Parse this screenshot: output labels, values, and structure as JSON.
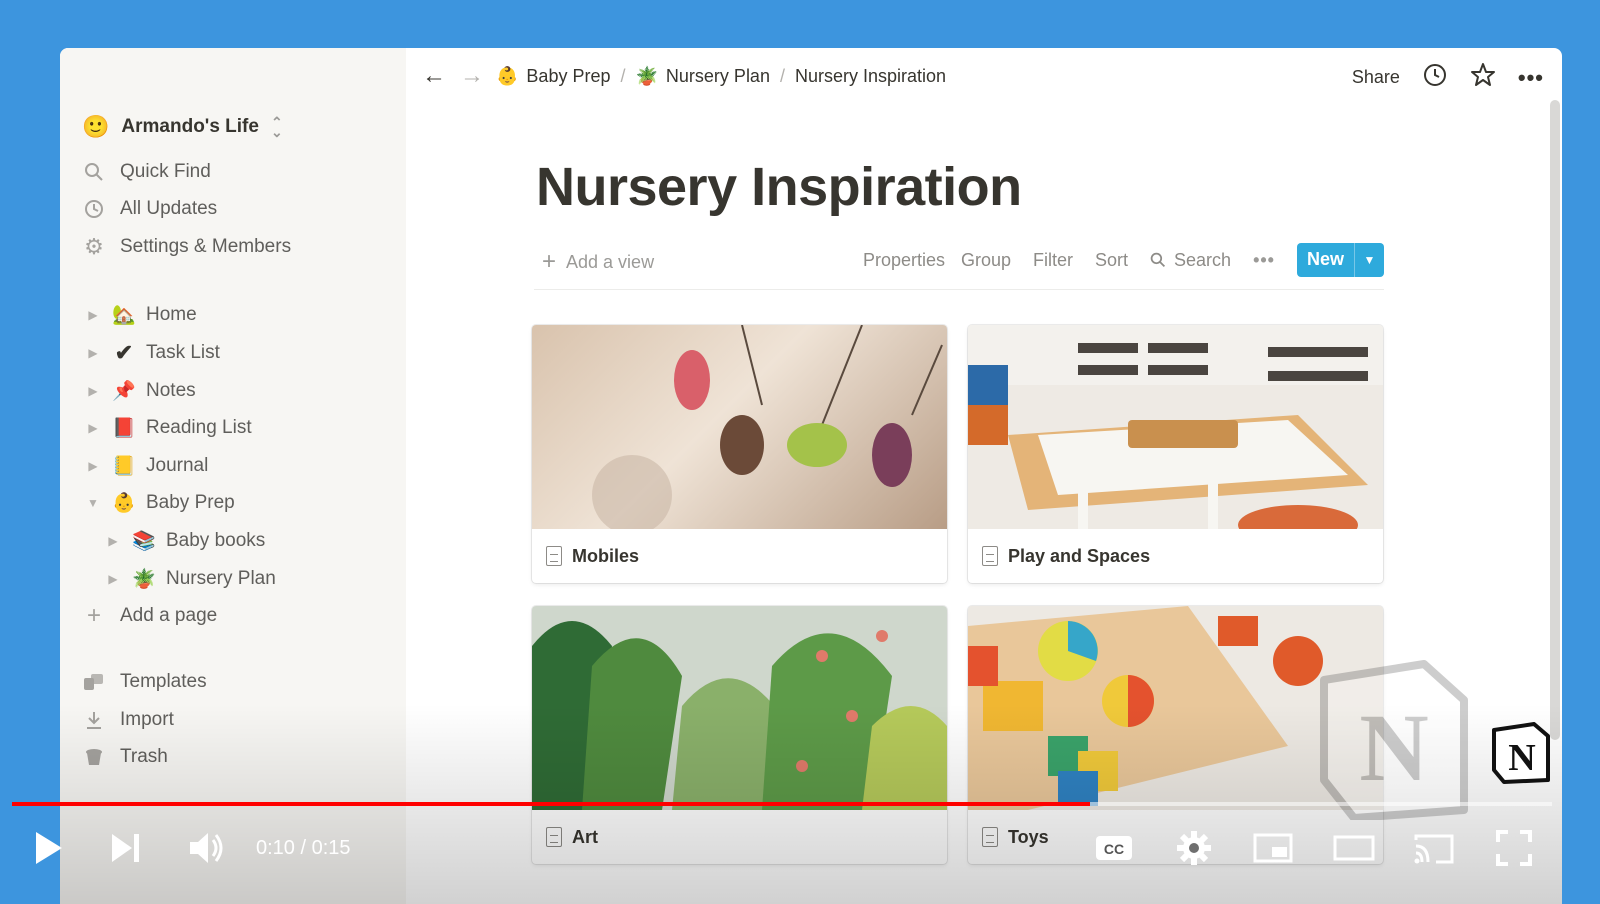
{
  "window": {
    "traffic": [
      "#ff5f57",
      "#febc2e",
      "#28c840"
    ]
  },
  "sidebar": {
    "workspace": {
      "name": "Armando's Life",
      "icon": "smiley-icon"
    },
    "nav": [
      {
        "label": "Quick Find",
        "icon": "search-icon"
      },
      {
        "label": "All Updates",
        "icon": "clock-icon"
      },
      {
        "label": "Settings & Members",
        "icon": "gear-icon"
      }
    ],
    "pages": [
      {
        "label": "Home",
        "emoji": "🏡",
        "expanded": false,
        "depth": 0
      },
      {
        "label": "Task List",
        "emoji": "✔",
        "expanded": false,
        "depth": 0
      },
      {
        "label": "Notes",
        "emoji": "📌",
        "expanded": false,
        "depth": 0
      },
      {
        "label": "Reading List",
        "emoji": "📕",
        "expanded": false,
        "depth": 0
      },
      {
        "label": "Journal",
        "emoji": "📒",
        "expanded": false,
        "depth": 0
      },
      {
        "label": "Baby Prep",
        "emoji": "👶",
        "expanded": true,
        "depth": 0
      },
      {
        "label": "Baby books",
        "emoji": "📚",
        "expanded": false,
        "depth": 1
      },
      {
        "label": "Nursery Plan",
        "emoji": "🪴",
        "expanded": false,
        "depth": 1
      }
    ],
    "add_page": "Add a page",
    "bottom": [
      {
        "label": "Templates",
        "icon": "templates-icon"
      },
      {
        "label": "Import",
        "icon": "import-icon"
      },
      {
        "label": "Trash",
        "icon": "trash-icon"
      }
    ]
  },
  "topbar": {
    "breadcrumbs": [
      {
        "label": "Baby Prep",
        "emoji": "👶"
      },
      {
        "label": "Nursery Plan",
        "emoji": "🪴"
      },
      {
        "label": "Nursery Inspiration",
        "emoji": ""
      }
    ],
    "separator": "/",
    "share": "Share"
  },
  "page": {
    "title": "Nursery Inspiration",
    "add_view": "Add a view",
    "toolbar": [
      "Properties",
      "Group",
      "Filter",
      "Sort"
    ],
    "search": "Search",
    "new_button": "New",
    "accent": "#2eaadc"
  },
  "gallery": [
    {
      "title": "Mobiles"
    },
    {
      "title": "Play and Spaces"
    },
    {
      "title": "Art"
    },
    {
      "title": "Toys"
    }
  ],
  "player": {
    "time": "0:10 / 0:15",
    "progress": 0.7,
    "progress_color": "#ff0000"
  }
}
